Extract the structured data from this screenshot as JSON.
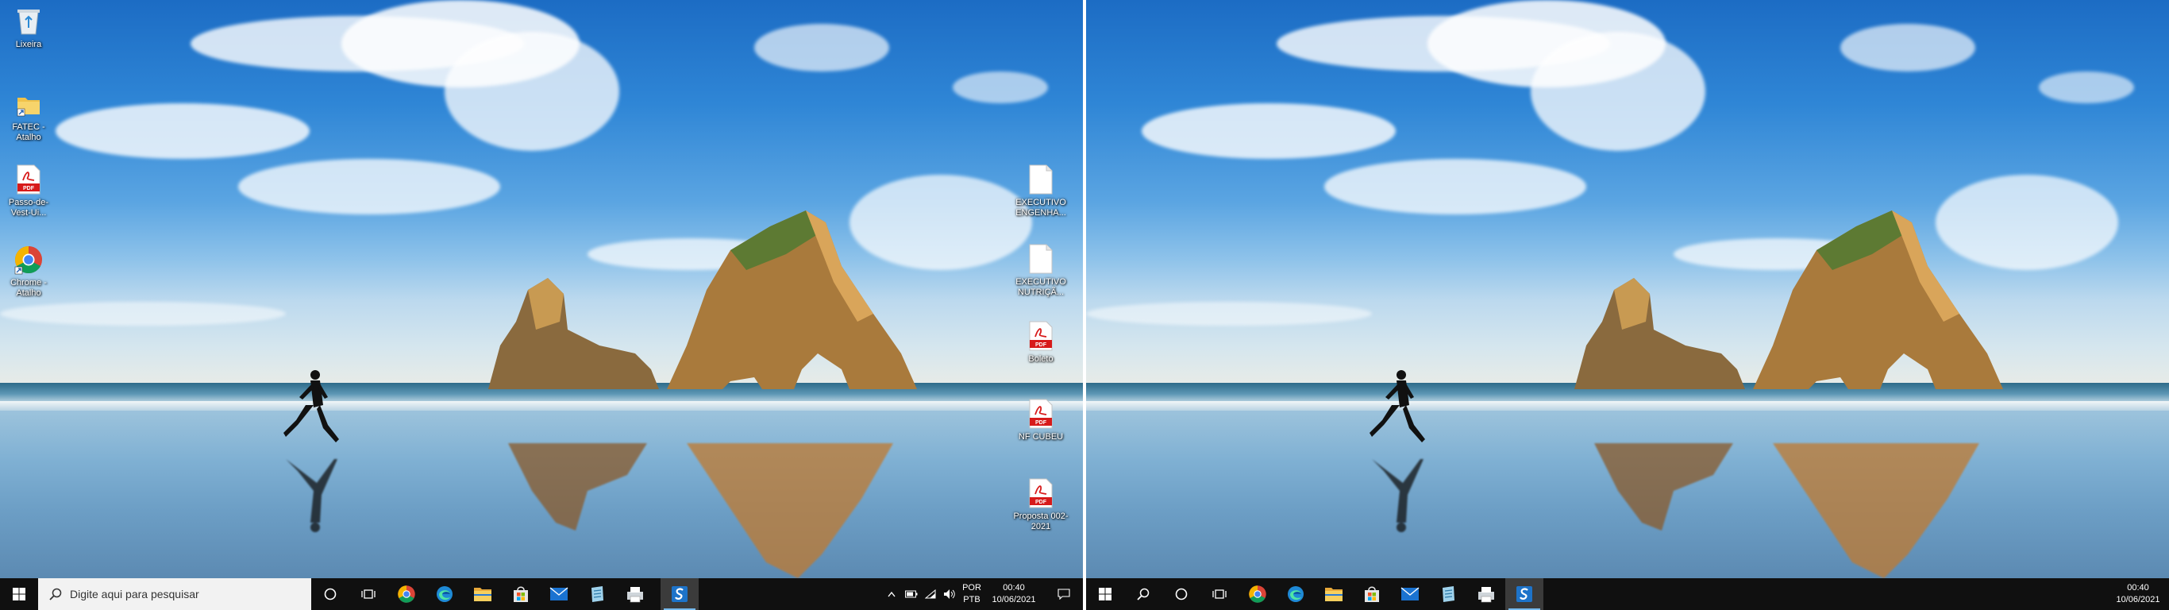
{
  "desktop_left": {
    "icons": [
      {
        "label": "Lixeira",
        "icon": "recycle-bin-icon"
      },
      {
        "label": "FATEC - Atalho",
        "icon": "folder-shortcut-icon"
      },
      {
        "label": "Passo-de-Vest-Ui...",
        "icon": "pdf-icon"
      },
      {
        "label": "Chrome - Atalho",
        "icon": "chrome-shortcut-icon"
      }
    ],
    "icons_right": [
      {
        "label": "EXECUTIVO ENGENHA...",
        "icon": "file-icon"
      },
      {
        "label": "EXECUTIVO NUTRIÇÃ...",
        "icon": "file-icon"
      },
      {
        "label": "Boleto",
        "icon": "pdf-icon"
      },
      {
        "label": "NF CUBEU",
        "icon": "pdf-icon"
      },
      {
        "label": "Proposta 002-2021",
        "icon": "pdf-icon"
      }
    ]
  },
  "taskbar_main": {
    "search_placeholder": "Digite aqui para pesquisar",
    "lang_1": "POR",
    "lang_2": "PTB",
    "time": "00:40",
    "date": "10/06/2021"
  },
  "taskbar_secondary": {
    "time": "00:40",
    "date": "10/06/2021"
  },
  "colors": {
    "taskbar_bg": "#101010",
    "active_indicator": "#76b9ed",
    "chrome_red": "#db4437",
    "chrome_yellow": "#f4b400",
    "chrome_green": "#0f9d58",
    "chrome_blue": "#4285f4"
  }
}
